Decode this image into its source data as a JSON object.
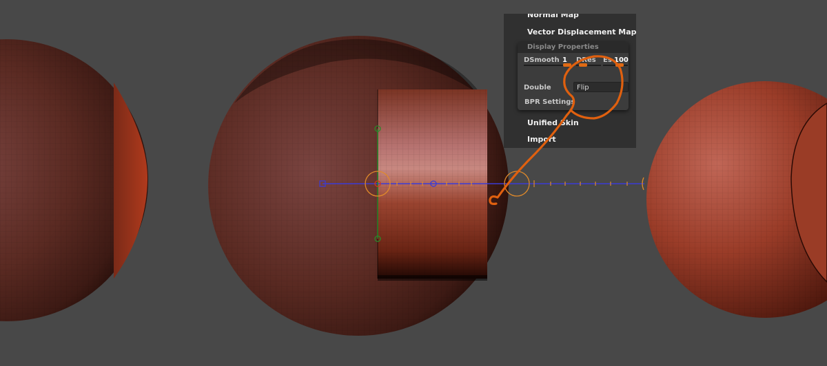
{
  "menu": {
    "normal_map": "Normal Map",
    "vector_displacement_map": "Vector Displacement Map",
    "unified_skin": "Unified Skin",
    "import": "Import"
  },
  "display_properties": {
    "title": "Display Properties",
    "dsmooth": {
      "label": "DSmooth",
      "value": "1"
    },
    "dres": {
      "label": "DRes",
      "value": ""
    },
    "es": {
      "label": "Es",
      "value": "100"
    },
    "double": {
      "label": "Double",
      "button": "Flip"
    },
    "bpr_settings": "BPR Settings"
  },
  "colors": {
    "canvas_bg": "#484848",
    "panel_bg": "#303030",
    "subpanel_bg": "#3c3c3c",
    "slider_accent": "#e06a14",
    "annotation_stroke": "#e0600f",
    "gizmo_axis_x": "#3b3bd6",
    "gizmo_axis_y": "#2a8a2a",
    "gizmo_center": "#e08a2a",
    "mesh_red": "#8a3426"
  },
  "icons": {
    "gizmo_pivot": "gizmo-pivot-icon",
    "gizmo_end": "gizmo-end-icon",
    "gizmo_handle": "gizmo-handle-icon"
  }
}
